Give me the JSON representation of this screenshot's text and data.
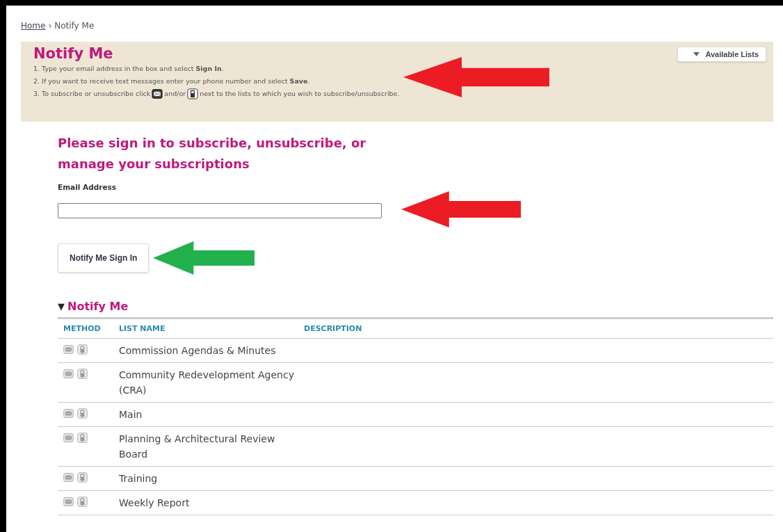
{
  "breadcrumb": {
    "home": "Home",
    "separator": "›",
    "current": "Notify Me"
  },
  "banner": {
    "title": "Notify Me",
    "steps": [
      {
        "parts": [
          {
            "kind": "text",
            "text": "1. Type your email address in the box and select **Sign In**."
          }
        ]
      },
      {
        "parts": [
          {
            "kind": "text",
            "text": "2. If you want to receive text messages enter your phone number and select **Save**."
          }
        ]
      },
      {
        "parts": [
          {
            "kind": "text",
            "text": "3. To subscribe or unsubscribe click"
          },
          {
            "kind": "email"
          },
          {
            "kind": "text",
            "text": "and/or"
          },
          {
            "kind": "phone"
          },
          {
            "kind": "text",
            "text": "next to the lists to which you wish to subscribe/unsubscribe."
          }
        ]
      }
    ],
    "arrow": {
      "color": "#ec1c24"
    },
    "lists_button": "Available Lists"
  },
  "signin": {
    "heading": "Please sign in to subscribe, unsubscribe, or manage your subscriptions",
    "email_label": "Email Address",
    "email_arrow": {
      "color": "#ec1c24"
    },
    "button": "Notify Me Sign In",
    "button_arrow": {
      "color": "#22b14c"
    }
  },
  "section": {
    "toggle": "▼",
    "title": "Notify Me",
    "expanded": true,
    "columns": [
      "METHOD",
      "LIST NAME",
      "DESCRIPTION"
    ],
    "rows": [
      {
        "name": "Commission Agendas & Minutes"
      },
      {
        "name": "Community Redevelopment Agency (CRA)"
      },
      {
        "name": "Main"
      },
      {
        "name": "Planning & Architectural Review Board"
      },
      {
        "name": "Training"
      },
      {
        "name": "Weekly Report"
      }
    ]
  }
}
